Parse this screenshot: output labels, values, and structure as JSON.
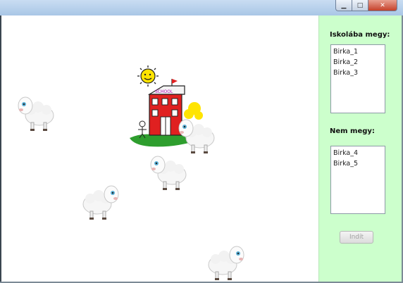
{
  "window": {
    "minimize_glyph": "▁",
    "maximize_glyph": "□",
    "close_glyph": "✕"
  },
  "sidebar": {
    "school_label": "Iskolába megy:",
    "school_list": [
      "Birka_1",
      "Birka_2",
      "Birka_3"
    ],
    "not_going_label": "Nem megy:",
    "not_going_list": [
      "Birka_4",
      "Birka_5"
    ],
    "start_button": "Indít"
  },
  "scene": {
    "icons": [
      "school-house-icon",
      "sun-icon",
      "sheep-icon"
    ],
    "colors": {
      "field_bg": "#ffffff",
      "sidebar_bg": "#ccffcc",
      "school_red": "#e02020",
      "sun_yellow": "#ffe400",
      "grass_green": "#2e9e2e"
    }
  }
}
